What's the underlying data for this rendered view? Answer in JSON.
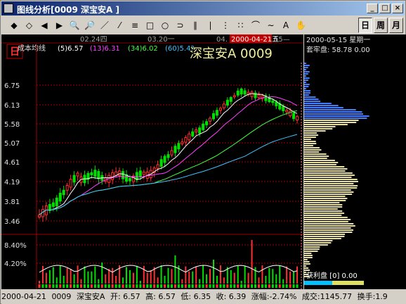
{
  "window": {
    "title": "图线分析[0009 深宝安A ]",
    "controls": [
      "_",
      "□",
      "×"
    ]
  },
  "toolbar": {
    "tools": [
      "◆",
      "◇",
      "◀",
      "▶",
      "🔍",
      "🔎",
      "／",
      "⁄",
      "≡",
      "□",
      "○",
      "⊃",
      "∥",
      "∣",
      "⋮",
      "∷",
      "⌒",
      "∼",
      "A",
      "✋"
    ],
    "periods": [
      {
        "label": "日",
        "active": true
      },
      {
        "label": "周",
        "active": false
      },
      {
        "label": "月",
        "active": false
      }
    ]
  },
  "chart": {
    "date_labels": [
      "02.24四",
      "03.20一",
      "04."
    ],
    "highlight_date": "2000-04-21五",
    "after_label": "15—",
    "indicator_name": "成本均线",
    "indicators": [
      {
        "text": "(5)6.57",
        "color": "#ffffff"
      },
      {
        "text": "(13)6.31",
        "color": "#ff40ff"
      },
      {
        "text": "(34)6.02",
        "color": "#40ff40"
      },
      {
        "text": "(60)5.4?",
        "color": "#40c0ff"
      }
    ],
    "stock_title": "深宝安A  0009",
    "icon_glyph": "日",
    "price_axis": [
      "6.75",
      "6.13",
      "5.58",
      "5.07",
      "4.61",
      "4.19",
      "3.81",
      "3.46"
    ],
    "volume_axis": [
      "8.40%",
      "4.20%"
    ],
    "colors": {
      "up": "#ff3030",
      "down": "#00e000",
      "ma5": "#ffffff",
      "ma13": "#ff40ff",
      "ma34": "#40ff40",
      "ma60": "#40c0ff",
      "title": "#f0f0a0",
      "grid": "#a00000"
    }
  },
  "side": {
    "date": "2000-05-15 星期一",
    "label": "套牢盘: 58.78 0.00",
    "footer": "获利盘 [0] 0.00"
  },
  "status": {
    "date": "2000-04-21",
    "code": "0009",
    "name": "深宝安A",
    "open": "开: 6.57",
    "high": "高: 6.57",
    "low": "低: 6.35",
    "close": "收: 6.39",
    "change": "涨幅:-2.74%",
    "amount": "成交:1145.77",
    "turnover": "换手:1.9"
  }
}
